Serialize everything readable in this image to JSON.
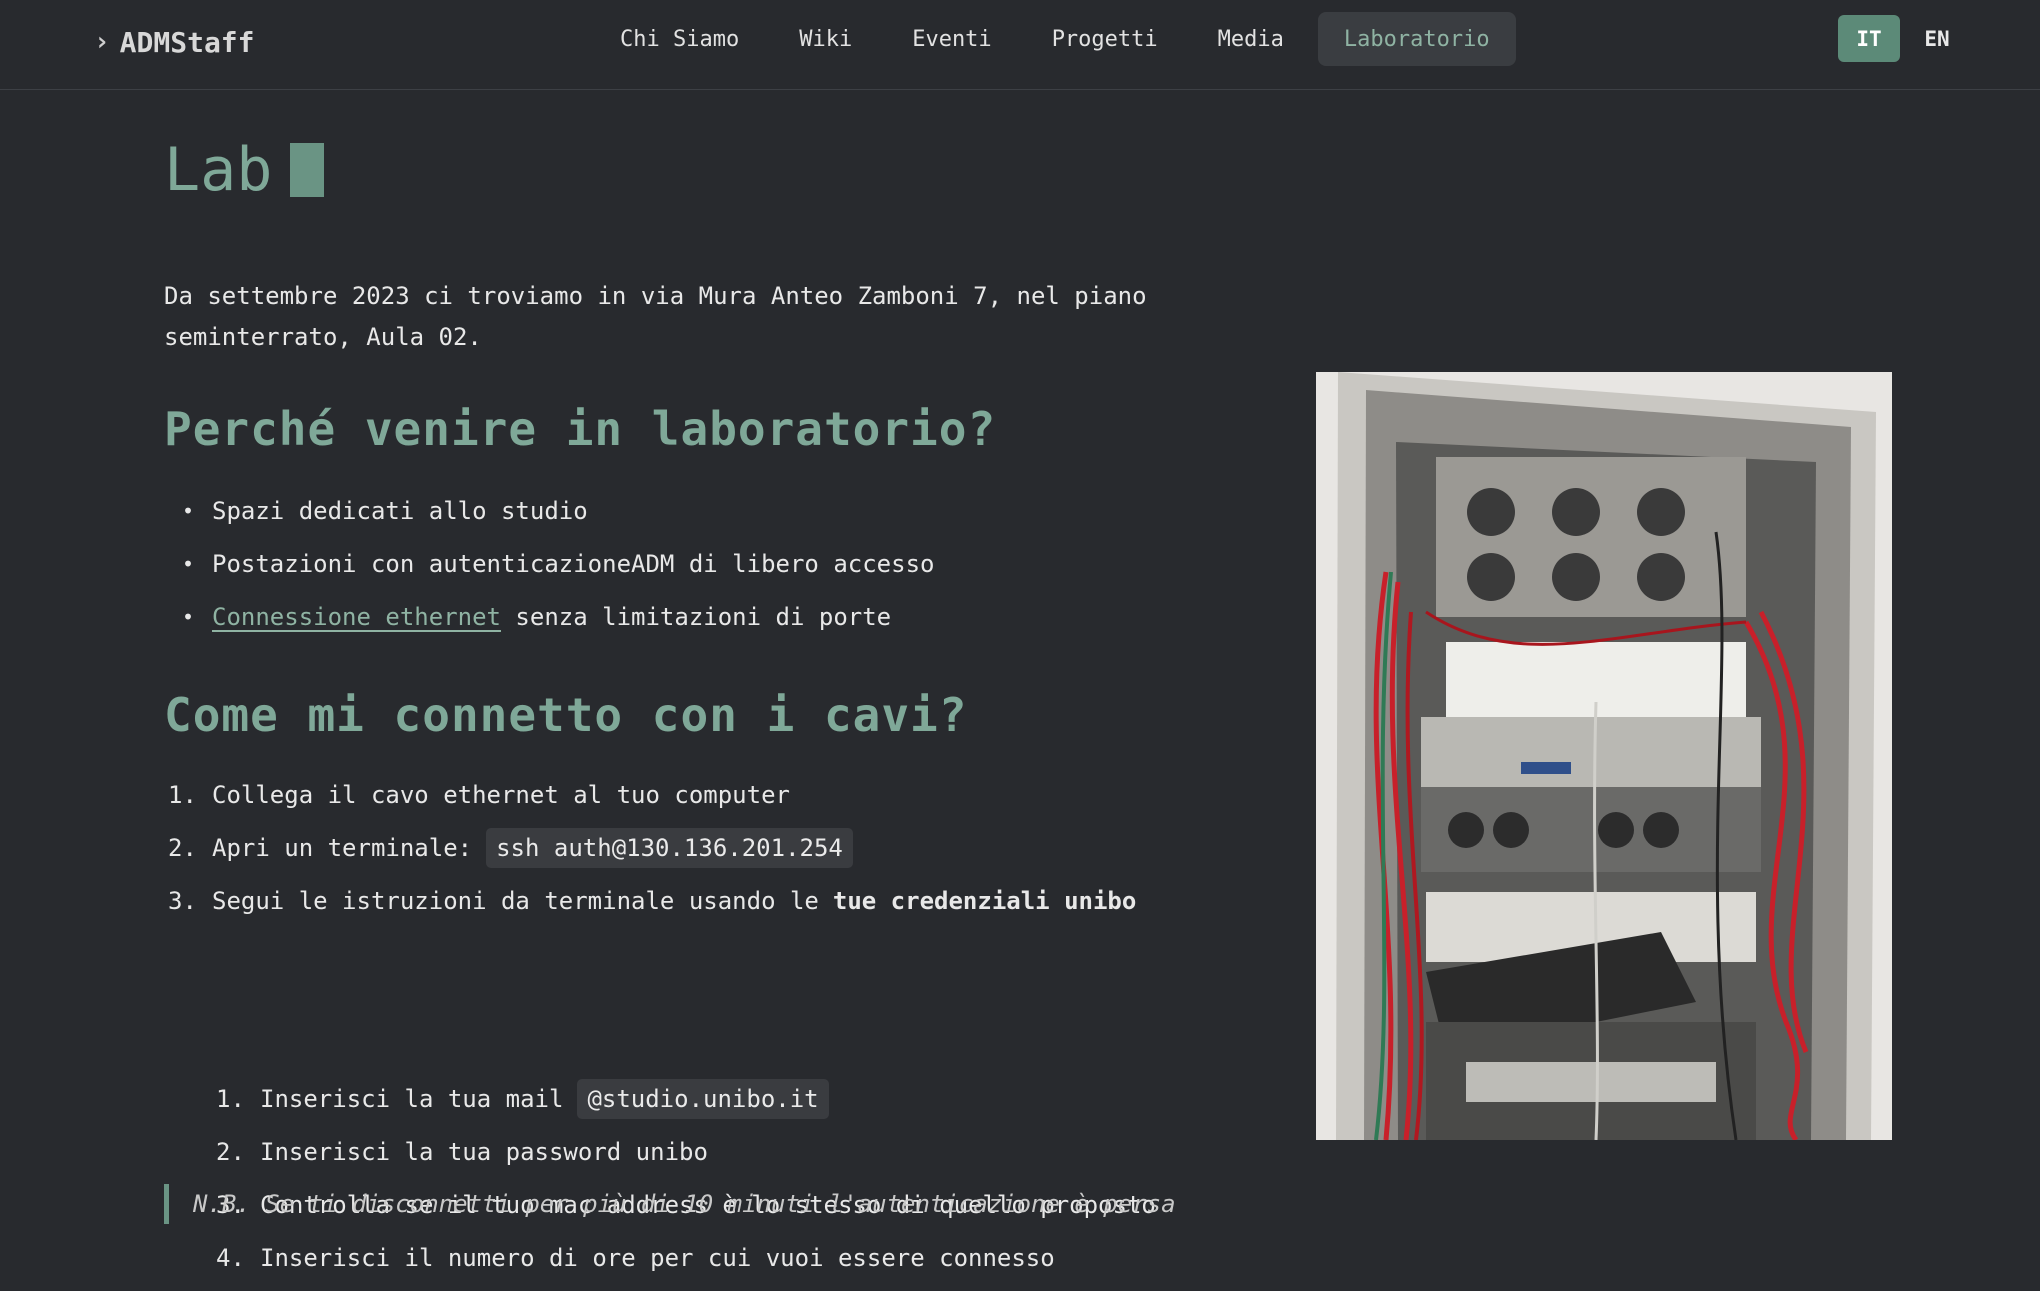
{
  "header": {
    "brand": "ADMStaff",
    "nav": [
      "Chi Siamo",
      "Wiki",
      "Eventi",
      "Progetti",
      "Media",
      "Laboratorio"
    ],
    "active_nav": "Laboratorio",
    "lang": {
      "it": "IT",
      "en": "EN",
      "active": "IT"
    }
  },
  "page": {
    "title": "Lab",
    "intro": "Da settembre 2023 ci troviamo in via Mura Anteo Zamboni 7, nel piano seminterrato, Aula 02.",
    "why": {
      "heading": "Perché venire in laboratorio?",
      "items": [
        {
          "text": "Spazi dedicati allo studio"
        },
        {
          "text": "Postazioni con autenticazioneADM di libero accesso"
        },
        {
          "link": "Connessione ethernet",
          "text": " senza limitazioni di porte"
        }
      ]
    },
    "how": {
      "heading": "Come mi connetto con i cavi?",
      "steps": [
        {
          "num": "1.",
          "text": "Collega il cavo ethernet al tuo computer"
        },
        {
          "num": "2.",
          "text": "Apri un terminale:",
          "code": "ssh auth@130.136.201.254"
        },
        {
          "num": "3.",
          "text": "Segui le istruzioni da terminale usando le",
          "bold": "tue credenziali unibo"
        }
      ],
      "substeps": [
        {
          "num": "1.",
          "text": "Inserisci la tua mail",
          "code": "@studio.unibo.it"
        },
        {
          "num": "2.",
          "text": "Inserisci la tua password unibo"
        },
        {
          "num": "3.",
          "text": "Controlla se il tuo mac address è lo stesso di quello proposto"
        },
        {
          "num": "4.",
          "text": "Inserisci il numero di ore per cui vuoi essere connesso"
        }
      ],
      "note": "N.B. Se ti disconnetti per più di 10 minuti l'autenticazione è persa"
    }
  },
  "colors": {
    "background": "#282a2e",
    "accent": "#7fa898",
    "accent_button": "#5c8a78",
    "cable_red": "#c8202a"
  },
  "icons": {
    "brand": "chevron-right-icon"
  }
}
